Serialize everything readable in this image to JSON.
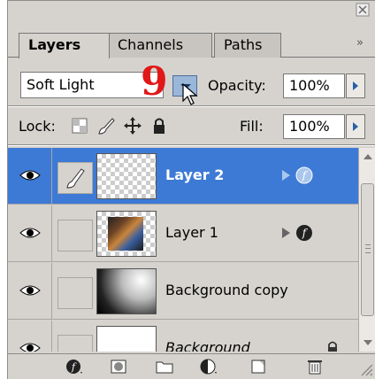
{
  "tabs": {
    "layers": "Layers",
    "channels": "Channels",
    "paths": "Paths",
    "menu": "»"
  },
  "blend_mode": "Soft Light",
  "annotation_number": "9",
  "opacity": {
    "label": "Opacity:",
    "value": "100%"
  },
  "lock": {
    "label": "Lock:"
  },
  "fill": {
    "label": "Fill:",
    "value": "100%"
  },
  "layers": [
    {
      "name": "Layer 2",
      "selected": true,
      "has_effects": true
    },
    {
      "name": "Layer 1",
      "selected": false,
      "has_effects": true
    },
    {
      "name": "Background copy",
      "selected": false,
      "has_effects": false
    },
    {
      "name": "Background",
      "selected": false,
      "locked": true
    }
  ],
  "colors": {
    "selection": "#3d7ad6",
    "annotation": "#e01818",
    "panel": "#d6d3ce"
  },
  "icons": {
    "close": "close-icon",
    "eye": "eye-icon",
    "brush": "brush-icon",
    "fx": "layer-style-icon",
    "lock": "lock-icon",
    "bottom": [
      "layer-style-icon",
      "mask-icon",
      "folder-icon",
      "adjustment-layer-icon",
      "new-layer-icon",
      "trash-icon"
    ]
  }
}
